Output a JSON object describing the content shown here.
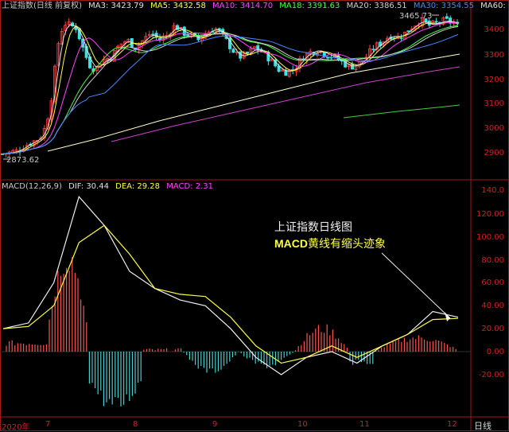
{
  "top_header": {
    "title": "上证指数(日线 前复权)",
    "ma": [
      {
        "label": "MA3: 3423.79",
        "color": "#e0e0e0"
      },
      {
        "label": "MA5: 3432.58",
        "color": "#ffff44"
      },
      {
        "label": "MA10: 3414.70",
        "color": "#ff44ff"
      },
      {
        "label": "MA18: 3391.63",
        "color": "#44ff44"
      },
      {
        "label": "MA20: 3386.51",
        "color": "#d0d0d0"
      },
      {
        "label": "MA30: 3354.55",
        "color": "#4488ff"
      },
      {
        "label": "MA60:",
        "color": "#e0e0e0"
      }
    ]
  },
  "macd_header": {
    "title": "MACD(12,26,9)",
    "dif": "DIF: 30.44",
    "dea": "DEA: 29.28",
    "macd": "MACD: 2.31",
    "colors": {
      "title": "#c8c8c8",
      "dif": "#e0e0e0",
      "dea": "#ffff44",
      "macd": "#ff44ff"
    }
  },
  "price_axis": [
    "3400",
    "3300",
    "3200",
    "3100",
    "3000",
    "2900"
  ],
  "macd_axis": [
    "140.0",
    "120.00",
    "100.00",
    "80.00",
    "60.00",
    "40.00",
    "20.00",
    "0.00",
    "-20.00"
  ],
  "x_axis": [
    "2020年",
    "7",
    "8",
    "9",
    "10",
    "11",
    "12"
  ],
  "peak_high": "3465.73",
  "peak_low": "2873.62",
  "annotation": {
    "line1": "上证指数日线图",
    "line2_bold": "MACD",
    "line2_rest": "黄线有缩头迹象"
  },
  "bottom_tab": "日线",
  "chart_data": [
    {
      "type": "line",
      "title": "上证指数(日线 前复权)",
      "ylim": [
        2873.62,
        3465.73
      ],
      "yticks": [
        2900,
        3000,
        3100,
        3200,
        3300,
        3400
      ],
      "x": [
        "7",
        "8",
        "9",
        "10",
        "11",
        "12"
      ],
      "series": [
        {
          "name": "MA3",
          "last": 3423.79
        },
        {
          "name": "MA5",
          "last": 3432.58
        },
        {
          "name": "MA10",
          "last": 3414.7
        },
        {
          "name": "MA18",
          "last": 3391.63
        },
        {
          "name": "MA20",
          "last": 3386.51
        },
        {
          "name": "MA30",
          "last": 3354.55
        }
      ],
      "high": 3465.73,
      "low": 2873.62
    },
    {
      "type": "line",
      "title": "MACD(12,26,9)",
      "ylim": [
        -20,
        140
      ],
      "x": [
        "7",
        "8",
        "9",
        "10",
        "11",
        "12"
      ],
      "series": [
        {
          "name": "DIF",
          "last": 30.44,
          "values": [
            20,
            25,
            60,
            135,
            110,
            70,
            55,
            45,
            40,
            20,
            -5,
            -20,
            -5,
            0,
            -10,
            5,
            15,
            35,
            30
          ]
        },
        {
          "name": "DEA",
          "last": 29.28,
          "values": [
            20,
            22,
            40,
            95,
            110,
            85,
            55,
            50,
            48,
            30,
            5,
            -10,
            -5,
            5,
            -5,
            5,
            15,
            28,
            29
          ]
        },
        {
          "name": "MACD",
          "last": 2.31
        }
      ]
    }
  ]
}
